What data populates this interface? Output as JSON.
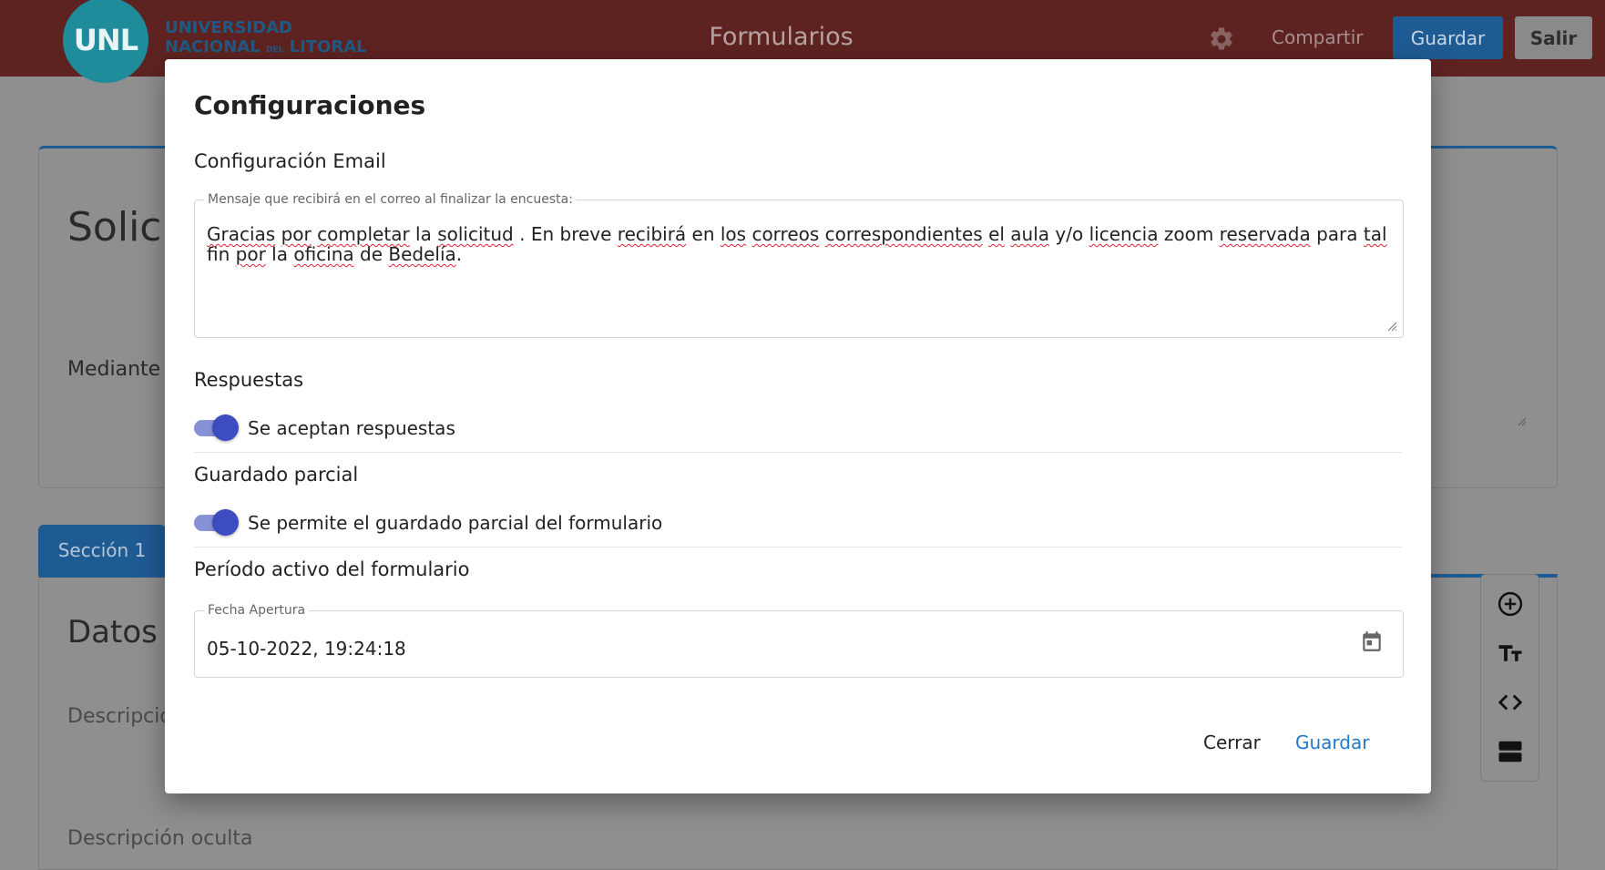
{
  "header": {
    "logo_mark": "UNL",
    "logo_line1": "UNIVERSIDAD",
    "logo_line2_a": "NACIONAL",
    "logo_line2_small": "DEL",
    "logo_line2_b": "LITORAL",
    "app_title": "Formularios",
    "share_label": "Compartir",
    "save_label": "Guardar",
    "exit_label": "Salir"
  },
  "background": {
    "form_title_partial": "Solici",
    "form_desc_partial": "Mediante",
    "section_tab": "Sección 1",
    "section_title_partial": "Datos d",
    "description_partial": "Descripció",
    "hidden_description": "Descripción oculta"
  },
  "modal": {
    "title": "Configuraciones",
    "email_section": "Configuración Email",
    "email_field_label": "Mensaje que recibirá en el correo al finalizar la encuesta:",
    "email_words": [
      {
        "t": "Gracias",
        "s": true
      },
      {
        "t": "por",
        "s": true
      },
      {
        "t": "completar",
        "s": true
      },
      {
        "t": "la",
        "s": false
      },
      {
        "t": "solicitud",
        "s": true
      },
      {
        "t": ". En breve",
        "s": false
      },
      {
        "t": "recibirá",
        "s": true
      },
      {
        "t": "en",
        "s": false
      },
      {
        "t": "los",
        "s": true
      },
      {
        "t": "correos",
        "s": true
      },
      {
        "t": "correspondientes",
        "s": true
      },
      {
        "t": "el",
        "s": true
      },
      {
        "t": "aula",
        "s": true
      },
      {
        "t": "y/o",
        "s": false
      },
      {
        "t": "licencia",
        "s": true
      },
      {
        "t": "zoom",
        "s": false
      },
      {
        "t": "reservada",
        "s": true
      },
      {
        "t": "para",
        "s": false
      },
      {
        "t": "tal",
        "s": true
      },
      {
        "t": "fin",
        "s": false
      },
      {
        "t": "por",
        "s": true
      },
      {
        "t": "la",
        "s": false
      },
      {
        "t": "oficina",
        "s": true
      },
      {
        "t": "de",
        "s": false
      },
      {
        "t": "Bedelía",
        "s": true
      },
      {
        "t": ".",
        "s": false
      }
    ],
    "responses_section": "Respuestas",
    "responses_toggle_label": "Se aceptan respuestas",
    "responses_toggle_on": true,
    "partial_section": "Guardado parcial",
    "partial_toggle_label": "Se permite el guardado parcial del formulario",
    "partial_toggle_on": true,
    "period_section": "Período activo del formulario",
    "open_date_label": "Fecha Apertura",
    "open_date_value": "05-10-2022, 19:24:18",
    "close_label": "Cerrar",
    "save_label": "Guardar"
  },
  "colors": {
    "topbar": "#5e2321",
    "primary": "#1f5b93",
    "toggle_knob": "#3d4cc0",
    "toggle_track": "#8891d6",
    "link_blue": "#2478c8"
  },
  "icons": {
    "settings": "gear-icon",
    "calendar": "calendar-icon",
    "add": "add-circle-icon",
    "text": "text-size-icon",
    "code": "code-icon",
    "section": "section-icon"
  }
}
